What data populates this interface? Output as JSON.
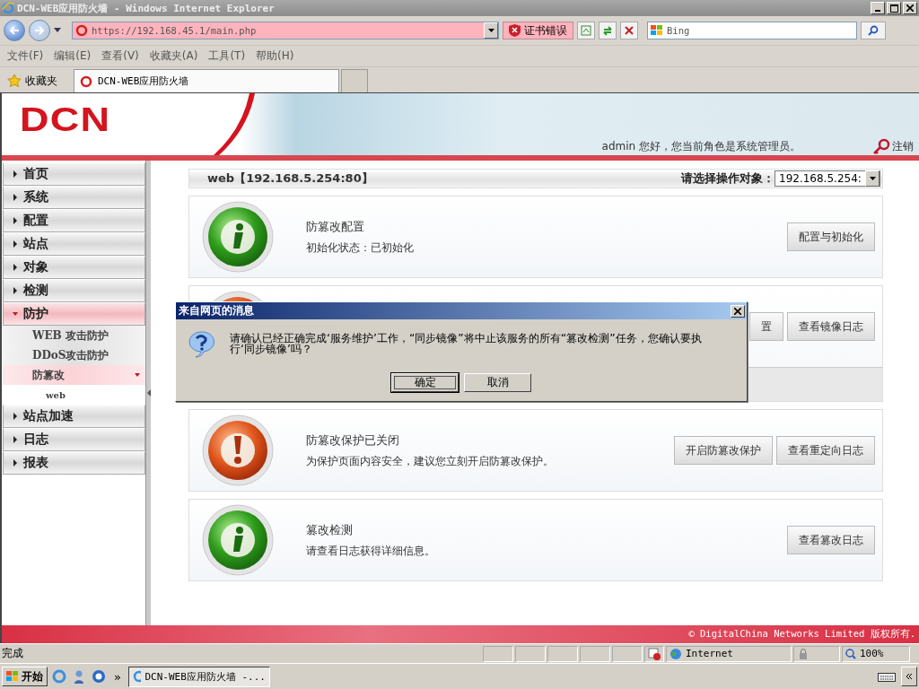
{
  "browser": {
    "title": "DCN-WEB应用防火墙 - Windows Internet Explorer",
    "address": "https://192.168.45.1/main.php",
    "cert_error": "证书错误",
    "search_placeholder": "Bing",
    "menu": [
      "文件(F)",
      "编辑(E)",
      "查看(V)",
      "收藏夹(A)",
      "工具(T)",
      "帮助(H)"
    ],
    "favorites": "收藏夹",
    "tabs": [
      {
        "label": "DCN-WEB应用防火墙",
        "selected": true
      }
    ],
    "status": {
      "text": "完成",
      "zone": "Internet",
      "zoom": "100%"
    }
  },
  "page": {
    "logo": "DCN",
    "greeting": "admin 您好，您当前角色是系统管理员。",
    "logout": "注销",
    "sidebar": {
      "items": [
        {
          "label": "首页",
          "expanded": false
        },
        {
          "label": "系统",
          "expanded": false
        },
        {
          "label": "配置",
          "expanded": false
        },
        {
          "label": "站点",
          "expanded": false
        },
        {
          "label": "对象",
          "expanded": false
        },
        {
          "label": "检测",
          "expanded": false
        },
        {
          "label": "防护",
          "expanded": true,
          "children": [
            {
              "label": "WEB 攻击防护",
              "selected": false
            },
            {
              "label": "DDoS攻击防护",
              "selected": false
            },
            {
              "label": "防篡改",
              "selected": true,
              "expanded": true,
              "children": [
                {
                  "label": "web",
                  "selected": false
                }
              ]
            }
          ]
        },
        {
          "label": "站点加速",
          "expanded": false
        },
        {
          "label": "日志",
          "expanded": false
        },
        {
          "label": "报表",
          "expanded": false
        }
      ]
    },
    "panel": {
      "title": "web【192.168.5.254:80】",
      "target_label": "请选择操作对象：",
      "target_value": "192.168.5.254:"
    },
    "cards": [
      {
        "kind": "info",
        "title": "防篡改配置",
        "detail": "初始化状态：已初始化",
        "footer": false,
        "buttons": [
          "配置与初始化"
        ]
      },
      {
        "kind": "warning",
        "footer": true,
        "buttons": [
          "置",
          "查看镜像日志"
        ]
      },
      {
        "kind": "warning",
        "title": "防篡改保护已关闭",
        "detail": "为保护页面内容安全，建议您立刻开启防篡改保护。",
        "footer": false,
        "buttons": [
          "开启防篡改保护",
          "查看重定向日志"
        ]
      },
      {
        "kind": "info",
        "title": "篡改检测",
        "detail": "请查看日志获得详细信息。",
        "footer": false,
        "buttons": [
          "查看篡改日志"
        ]
      }
    ],
    "footer": "© DigitalChina Networks Limited 版权所有."
  },
  "dialog": {
    "title": "来自网页的消息",
    "message": "请确认已经正确完成‘服务维护’工作，“同步镜像”将中止该服务的所有“篡改检测”任务，您确认要执行‘同步镜像’吗？",
    "buttons": [
      {
        "label": "确定",
        "selected": true
      },
      {
        "label": "取消",
        "selected": false
      }
    ]
  },
  "taskbar": {
    "start": "开始",
    "more": "»",
    "tasks": [
      {
        "label": "DCN-WEB应用防火墙 -...",
        "selected": true
      }
    ]
  }
}
